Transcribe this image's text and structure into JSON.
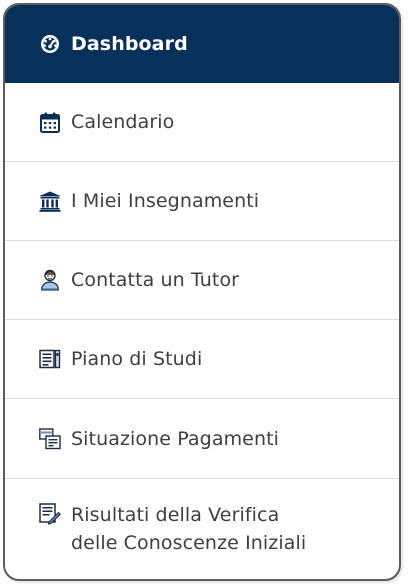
{
  "menu": {
    "items": [
      {
        "label": "Dashboard",
        "icon": "dashboard-icon",
        "active": true
      },
      {
        "label": "Calendario",
        "icon": "calendar-icon"
      },
      {
        "label": "I Miei Insegnamenti",
        "icon": "university-icon"
      },
      {
        "label": "Contatta un Tutor",
        "icon": "tutor-icon"
      },
      {
        "label": "Piano di Studi",
        "icon": "study-plan-icon"
      },
      {
        "label": "Situazione Pagamenti",
        "icon": "payments-icon"
      },
      {
        "label_line1": "Risultati della Verifica",
        "label_line2": "delle Conoscenze Iniziali",
        "icon": "test-results-icon"
      }
    ]
  },
  "colors": {
    "active_bg": "#07305a",
    "active_text": "#ffffff",
    "text": "#3f3f3f",
    "icon": "#0a2f57",
    "divider": "#dcdcdc",
    "border": "#5c5c5c"
  }
}
